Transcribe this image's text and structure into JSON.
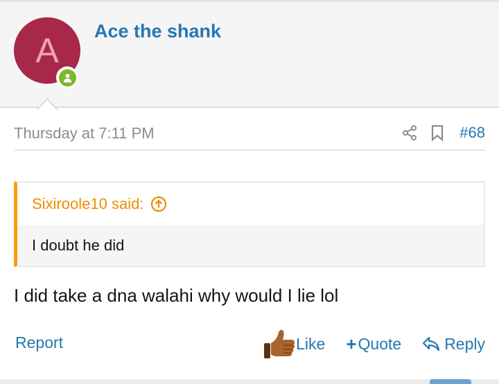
{
  "post": {
    "author": "Ace the shank",
    "avatar_letter": "A",
    "date": "Thursday at 7:11 PM",
    "number": "#68",
    "quote": {
      "author_line": "Sixiroole10 said:",
      "text": "I doubt he did"
    },
    "message": "I did take a dna walahi why would I lie lol"
  },
  "actions": {
    "report": "Report",
    "like": "Like",
    "quote": "Quote",
    "reply": "Reply"
  },
  "colors": {
    "link": "#2577b1",
    "avatar_bg": "#a8284a",
    "online": "#7cb82f",
    "quote_accent": "#f59d12"
  },
  "icons": [
    "share-icon",
    "bookmark-icon",
    "jump-to-quote-icon",
    "thumbs-up-icon",
    "plus-icon",
    "reply-icon",
    "user-icon"
  ]
}
